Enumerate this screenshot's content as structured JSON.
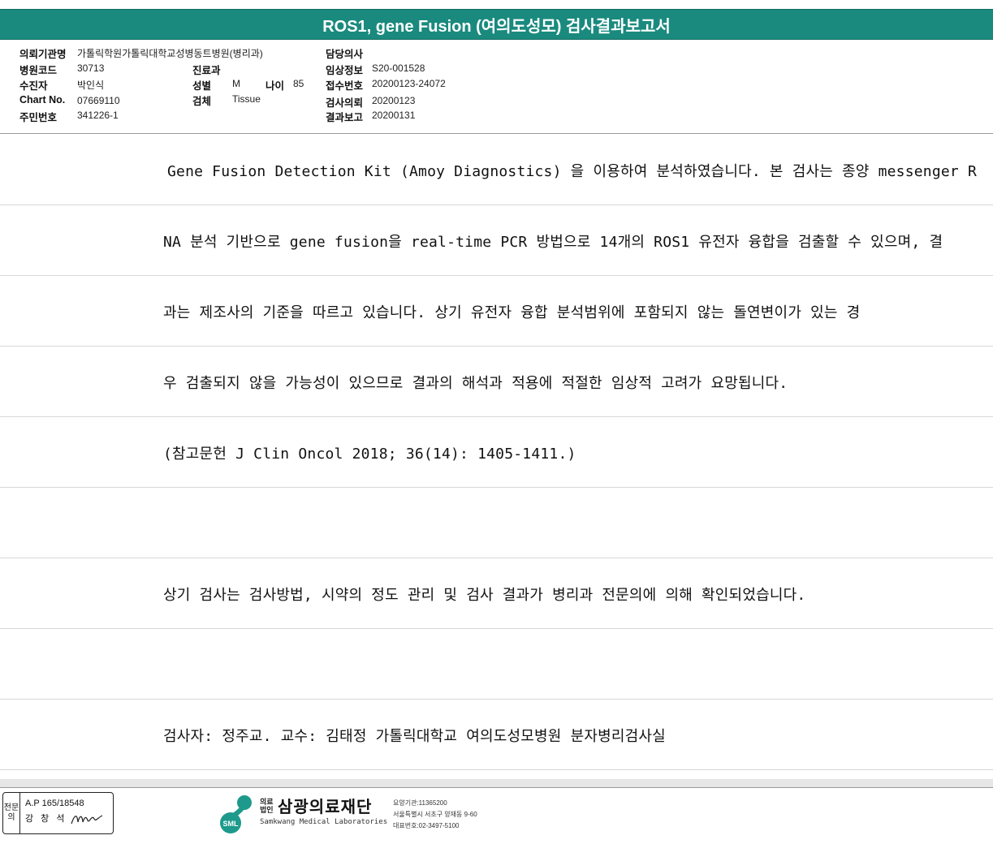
{
  "report": {
    "title": "ROS1, gene Fusion (여의도성모) 검사결과보고서"
  },
  "patient_info": {
    "institution_label": "의뢰기관명",
    "institution_value": "가톨릭학원가톨릭대학교성병동트병원(병리과)",
    "hospital_code_label": "병원코드",
    "hospital_code_value": "30713",
    "recipient_label": "수진자",
    "recipient_value": "박인식",
    "chart_no_label": "Chart No.",
    "chart_no_value": "07669110",
    "resident_no_label": "주민번호",
    "resident_no_value": "341226-1",
    "department_label": "진료과",
    "department_value": "",
    "sex_label": "성별",
    "sex_value": "M",
    "age_label": "나이",
    "age_value": "85",
    "specimen_label": "검체",
    "specimen_value": "Tissue",
    "doctor_label": "담당의사",
    "doctor_value": "",
    "clinical_info_label": "임상정보",
    "clinical_info_value": "S20-001528",
    "accession_label": "접수번호",
    "accession_value": "20200123-24072",
    "request_label": "검사의뢰",
    "request_value": "20200123",
    "report_date_label": "결과보고",
    "report_date_value": "20200131"
  },
  "content_lines": [
    " Gene Fusion Detection Kit (Amoy Diagnostics) 을 이용하여 분석하였습니다. 본 검사는 종양 messenger R",
    "NA 분석 기반으로 gene fusion을 real-time PCR 방법으로 14개의 ROS1 유전자 융합을 검출할 수 있으며, 결",
    "과는 제조사의 기준을 따르고 있습니다. 상기 유전자 융합 분석범위에 포함되지 않는  돌연변이가 있는 경",
    "우 검출되지 않을 가능성이 있으므로 결과의 해석과 적용에 적절한 임상적 고려가 요망됩니다.",
    "(참고문헌 J Clin Oncol 2018; 36(14): 1405-1411.)",
    "",
    "상기 검사는 검사방법, 시약의 정도 관리 및 검사 결과가 병리과 전문의에 의해 확인되었습니다.",
    "",
    "검사자: 정주교. 교수: 김태정 가톨릭대학교 여의도성모병원 분자병리검사실"
  ],
  "footer": {
    "stamp_side": "전문의",
    "stamp_ap": "A.P 165/18548",
    "stamp_name": "강 창 석",
    "logo_mark_text": "SML",
    "logo_subtitle": "의료법인",
    "logo_name": "삼광의료재단",
    "logo_english": "Samkwang Medical Laboratories",
    "logo_meta_1": "요양기관:11365200",
    "logo_meta_2": "서울특별시 서초구 양재동 9-60",
    "logo_meta_3": "대표번호:02-3497-5100",
    "colors": {
      "header_teal": "#1a8a7e",
      "logo_teal": "#1d9a8c"
    }
  }
}
